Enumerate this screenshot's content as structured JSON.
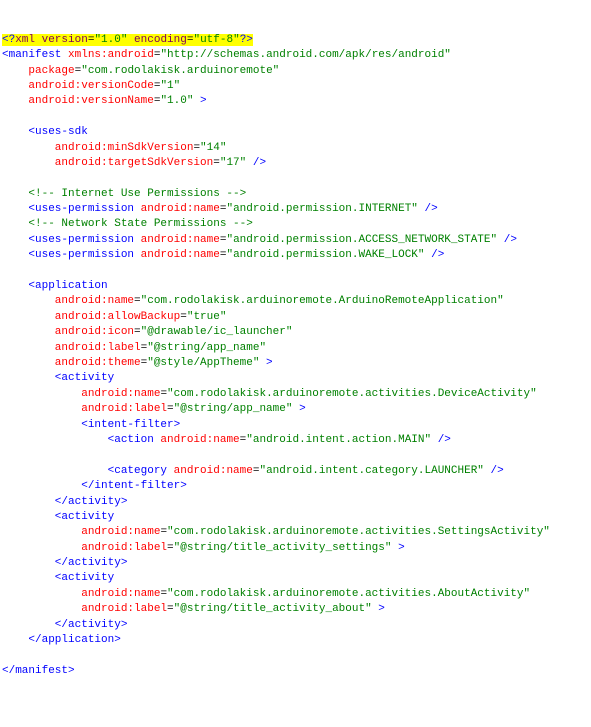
{
  "l1": {
    "a": "<?",
    "b": "xml version",
    "c": "=",
    "d": "\"1.0\"",
    "e": " encoding",
    "f": "=",
    "g": "\"utf-8\"",
    "h": "?>"
  },
  "l2": {
    "a": "<manifest",
    "b": " xmlns:android",
    "c": "=",
    "d": "\"http://schemas.android.com/apk/res/android\""
  },
  "l3": {
    "a": "    package",
    "b": "=",
    "c": "\"com.rodolakisk.arduinoremote\""
  },
  "l4": {
    "a": "    android:versionCode",
    "b": "=",
    "c": "\"1\""
  },
  "l5": {
    "a": "    android:versionName",
    "b": "=",
    "c": "\"1.0\"",
    "d": " >"
  },
  "l7": {
    "a": "    <uses-sdk"
  },
  "l8": {
    "a": "        android:minSdkVersion",
    "b": "=",
    "c": "\"14\""
  },
  "l9": {
    "a": "        android:targetSdkVersion",
    "b": "=",
    "c": "\"17\"",
    "d": " />"
  },
  "l11": {
    "a": "    <!-- Internet Use Permissions -->"
  },
  "l12": {
    "a": "    <uses-permission",
    "b": " android:name",
    "c": "=",
    "d": "\"android.permission.INTERNET\"",
    "e": " />"
  },
  "l13": {
    "a": "    <!-- Network State Permissions -->"
  },
  "l14": {
    "a": "    <uses-permission",
    "b": " android:name",
    "c": "=",
    "d": "\"android.permission.ACCESS_NETWORK_STATE\"",
    "e": " />"
  },
  "l15": {
    "a": "    <uses-permission",
    "b": " android:name",
    "c": "=",
    "d": "\"android.permission.WAKE_LOCK\"",
    "e": " />"
  },
  "l17": {
    "a": "    <application"
  },
  "l18": {
    "a": "        android:name",
    "b": "=",
    "c": "\"com.rodolakisk.arduinoremote.ArduinoRemoteApplication\""
  },
  "l19": {
    "a": "        android:allowBackup",
    "b": "=",
    "c": "\"true\""
  },
  "l20": {
    "a": "        android:icon",
    "b": "=",
    "c": "\"@drawable/ic_launcher\""
  },
  "l21": {
    "a": "        android:label",
    "b": "=",
    "c": "\"@string/app_name\""
  },
  "l22": {
    "a": "        android:theme",
    "b": "=",
    "c": "\"@style/AppTheme\"",
    "d": " >"
  },
  "l23": {
    "a": "        <activity"
  },
  "l24": {
    "a": "            android:name",
    "b": "=",
    "c": "\"com.rodolakisk.arduinoremote.activities.DeviceActivity\""
  },
  "l25": {
    "a": "            android:label",
    "b": "=",
    "c": "\"@string/app_name\"",
    "d": " >"
  },
  "l26": {
    "a": "            <intent-filter>"
  },
  "l27": {
    "a": "                <action",
    "b": " android:name",
    "c": "=",
    "d": "\"android.intent.action.MAIN\"",
    "e": " />"
  },
  "l29": {
    "a": "                <category",
    "b": " android:name",
    "c": "=",
    "d": "\"android.intent.category.LAUNCHER\"",
    "e": " />"
  },
  "l30": {
    "a": "            </intent-filter>"
  },
  "l31": {
    "a": "        </activity>"
  },
  "l32": {
    "a": "        <activity"
  },
  "l33": {
    "a": "            android:name",
    "b": "=",
    "c": "\"com.rodolakisk.arduinoremote.activities.SettingsActivity\""
  },
  "l34": {
    "a": "            android:label",
    "b": "=",
    "c": "\"@string/title_activity_settings\"",
    "d": " >"
  },
  "l35": {
    "a": "        </activity>"
  },
  "l36": {
    "a": "        <activity"
  },
  "l37": {
    "a": "            android:name",
    "b": "=",
    "c": "\"com.rodolakisk.arduinoremote.activities.AboutActivity\""
  },
  "l38": {
    "a": "            android:label",
    "b": "=",
    "c": "\"@string/title_activity_about\"",
    "d": " >"
  },
  "l39": {
    "a": "        </activity>"
  },
  "l40": {
    "a": "    </application>"
  },
  "l42": {
    "a": "</manifest>"
  }
}
